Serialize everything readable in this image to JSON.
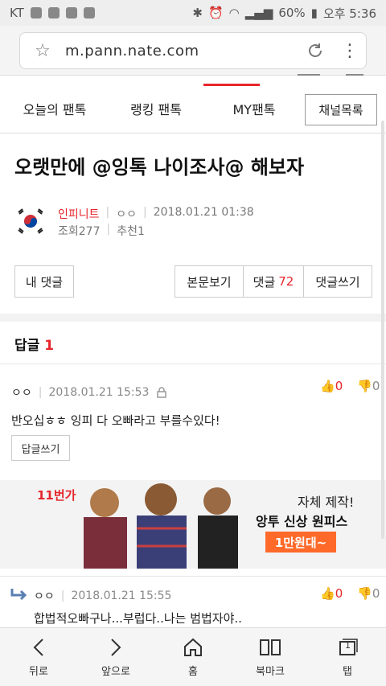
{
  "status_bar": {
    "carrier": "KT",
    "battery": "60%",
    "time": "오후 5:36"
  },
  "browser": {
    "url": "m.pann.nate.com"
  },
  "nav_tabs": {
    "today": "오늘의 팬톡",
    "ranking": "랭킹 팬톡",
    "my": "MY팬톡",
    "channel": "채널목록"
  },
  "post": {
    "title": "오랫만에 @잉톡 나이조사@ 해보자",
    "author": "인피니트",
    "nick": "ㅇㅇ",
    "date": "2018.01.21 01:38",
    "views": "조회277",
    "recommend": "추천1"
  },
  "buttons": {
    "my_comments": "내 댓글",
    "view_body": "본문보기",
    "comments": "댓글",
    "comments_count": "72",
    "write_comment": "댓글쓰기"
  },
  "replies": {
    "label": "답글",
    "count": "1"
  },
  "comment1": {
    "nick": "ㅇㅇ",
    "date": "2018.01.21 15:53",
    "up": "0",
    "down": "0",
    "text": "반오십ㅎㅎ 잉피 다 오빠라고 부를수있다!",
    "reply_button": "답글쓰기"
  },
  "ad": {
    "logo": "11번가",
    "line1": "자체 제작!",
    "line2": "앙투 신상 원피스",
    "badge": "1만원대~"
  },
  "comment2": {
    "nick": "ㅇㅇ",
    "date": "2018.01.21 15:55",
    "up": "0",
    "down": "0",
    "text": "합법적오빠구나...부럽다..나는 범법자야.."
  },
  "bottom_nav": {
    "back": "뒤로",
    "forward": "앞으로",
    "home": "홈",
    "bookmarks": "북마크",
    "tabs": "탭",
    "tab_count": "1"
  }
}
